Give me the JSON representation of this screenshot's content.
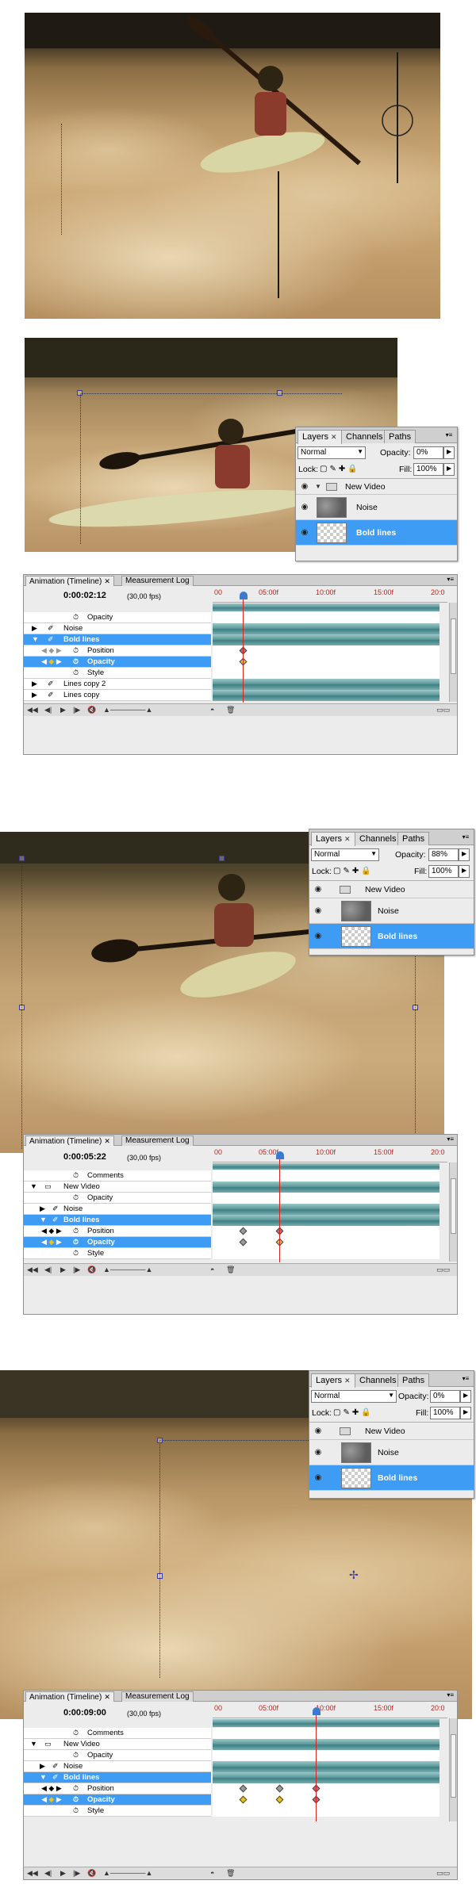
{
  "layers_panel": {
    "tabs": [
      {
        "label": "Layers",
        "active": true
      },
      {
        "label": "Channels",
        "active": false
      },
      {
        "label": "Paths",
        "active": false
      }
    ],
    "blend_mode": "Normal",
    "opacity_label": "Opacity:",
    "lock_label": "Lock:",
    "fill_label": "Fill:",
    "fill_value": "100%",
    "layers": [
      {
        "name": "New Video",
        "type": "group"
      },
      {
        "name": "Noise",
        "type": "layer"
      },
      {
        "name": "Bold lines",
        "type": "layer",
        "selected": true
      }
    ]
  },
  "frames": [
    {
      "layers_opacity": "0%",
      "timeline": {
        "timecode": "0:00:02:12",
        "fps": "(30,00 fps)",
        "rows": [
          "Opacity",
          "Noise",
          "Bold lines",
          "Position",
          "Opacity",
          "Style",
          "Lines copy 2",
          "Lines copy"
        ]
      }
    },
    {
      "layers_opacity": "88%",
      "timeline": {
        "timecode": "0:00:05:22",
        "fps": "(30,00 fps)",
        "rows": [
          "Comments",
          "New Video",
          "Opacity",
          "Noise",
          "Bold lines",
          "Position",
          "Opacity",
          "Style"
        ]
      }
    },
    {
      "layers_opacity": "0%",
      "timeline": {
        "timecode": "0:00:09:00",
        "fps": "(30,00 fps)",
        "rows": [
          "Comments",
          "New Video",
          "Opacity",
          "Noise",
          "Bold lines",
          "Position",
          "Opacity",
          "Style"
        ]
      }
    }
  ],
  "timeline_panel": {
    "tabs": [
      {
        "label": "Animation (Timeline)",
        "active": true
      },
      {
        "label": "Measurement Log",
        "active": false
      }
    ],
    "ruler_labels": [
      "00",
      "05:00f",
      "10:00f",
      "15:00f",
      "20:0"
    ]
  },
  "colors": {
    "selection_blue": "#3f9cf5",
    "playhead_red": "#d4261f",
    "keyframe_yellow": "#e8c21e",
    "track_teal": "#5d9a9c"
  }
}
